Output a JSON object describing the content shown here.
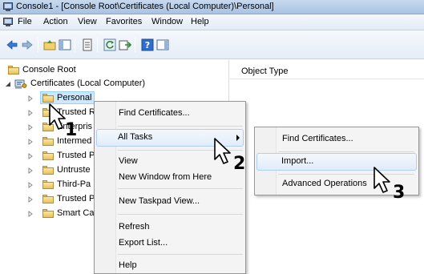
{
  "window": {
    "title": "Console1 - [Console Root\\Certificates (Local Computer)\\Personal]"
  },
  "menubar": {
    "items": [
      "File",
      "Action",
      "View",
      "Favorites",
      "Window",
      "Help"
    ]
  },
  "toolbar": {
    "icons": [
      "back-arrow-icon",
      "forward-arrow-icon",
      "up-folder-icon",
      "show-hide-tree-icon",
      "properties-icon",
      "refresh-icon",
      "export-list-icon",
      "help-icon",
      "show-hide-action-pane-icon"
    ]
  },
  "tree": {
    "root": "Console Root",
    "snapin": "Certificates (Local Computer)",
    "folders": [
      "Personal",
      "Trusted R",
      "Enterpris",
      "Intermed",
      "Trusted P",
      "Untruste",
      "Third-Pa",
      "Trusted P",
      "Smart Ca"
    ]
  },
  "list_pane": {
    "column_header": "Object Type"
  },
  "context_menu": {
    "items": [
      "Find Certificates...",
      "All Tasks",
      "View",
      "New Window from Here",
      "New Taskpad View...",
      "Refresh",
      "Export List...",
      "Help"
    ]
  },
  "submenu": {
    "items": [
      "Find Certificates...",
      "Import...",
      "Advanced Operations"
    ]
  },
  "steps": [
    "1",
    "2",
    "3"
  ],
  "colors": {
    "selection": "#cce8ff",
    "menu_highlight": "#e1ecf9",
    "titlebar": "#b9cfe9"
  }
}
